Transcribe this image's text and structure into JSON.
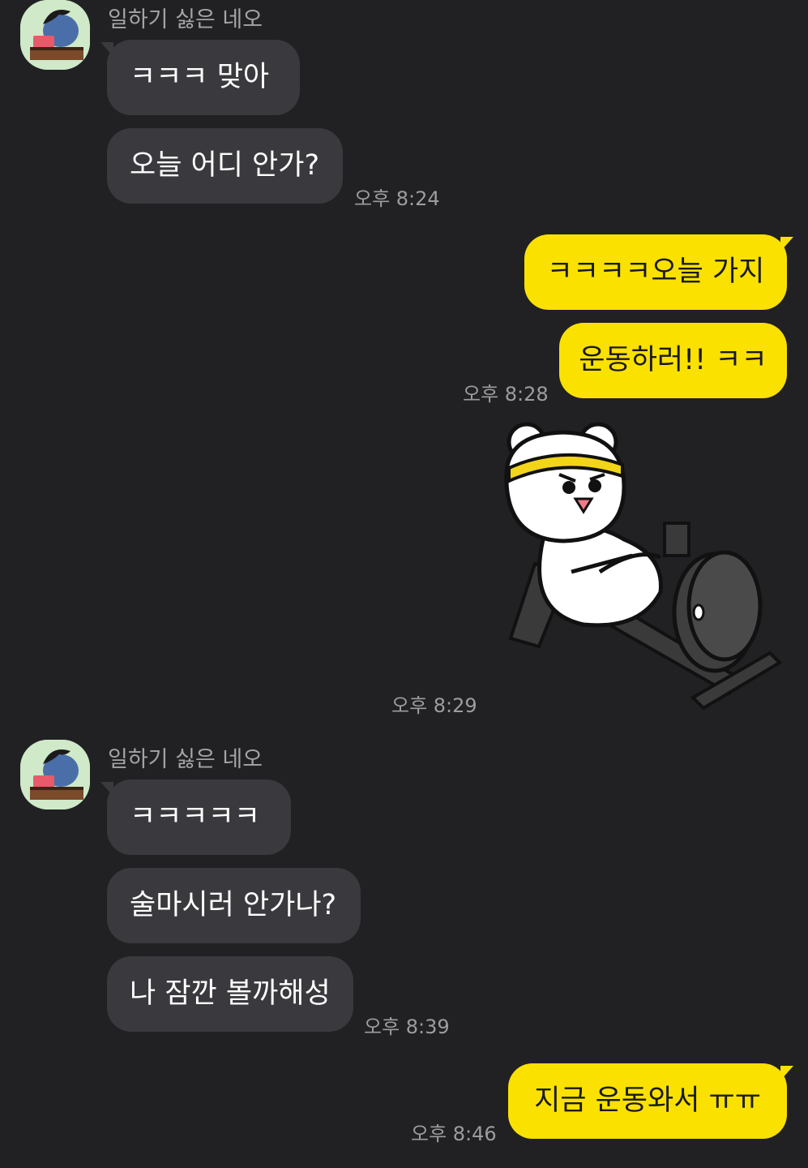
{
  "chat": {
    "sender_name": "일하기 싫은 네오",
    "colors": {
      "background": "#212124",
      "incoming_bubble": "#3a3a3e",
      "outgoing_bubble": "#fae100"
    },
    "groups": [
      {
        "sender": "일하기 싫은 네오",
        "messages": [
          "ㅋㅋㅋ 맞아",
          "오늘 어디 안가?"
        ],
        "time": "오후 8:24"
      },
      {
        "messages": [
          "ㅋㅋㅋㅋ오늘 가지",
          "운동하러!! ㅋㅋ"
        ],
        "time": "오후 8:28"
      },
      {
        "sticker": "bear-rowing-machine-sticker",
        "time": "오후 8:29"
      },
      {
        "sender": "일하기 싫은 네오",
        "messages": [
          "ㅋㅋㅋㅋㅋ",
          "술마시러 안가나?",
          "나 잠깐 볼까해성"
        ],
        "time": "오후 8:39"
      },
      {
        "messages": [
          "지금 운동와서 ㅠㅠ"
        ],
        "time": "오후 8:46"
      }
    ]
  }
}
